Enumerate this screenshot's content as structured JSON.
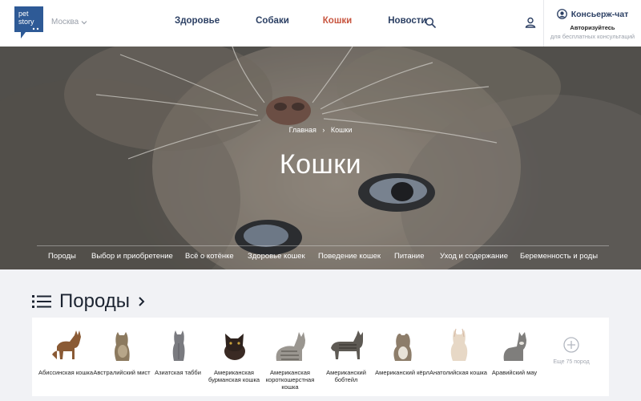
{
  "header": {
    "logo_line1": "pet",
    "logo_line2": "story",
    "city": "Москва",
    "nav": [
      {
        "label": "Здоровье",
        "active": false
      },
      {
        "label": "Собаки",
        "active": false
      },
      {
        "label": "Кошки",
        "active": true
      },
      {
        "label": "Новости",
        "active": false
      }
    ],
    "concierge": {
      "title": "Консьерж-чат",
      "subtitle": "Авторизуйтесь",
      "subtitle2": "для бесплатных консультаций"
    }
  },
  "hero": {
    "breadcrumb": {
      "home": "Главная",
      "current": "Кошки"
    },
    "title": "Кошки",
    "sub_nav": [
      "Породы",
      "Выбор и приобретение",
      "Всё о котёнке",
      "Здоровье кошек",
      "Поведение кошек",
      "Питание",
      "Уход и содержание",
      "Беременность и роды"
    ]
  },
  "breeds": {
    "title": "Породы",
    "items": [
      {
        "name": "Абиссинская кошка",
        "color": "#8a5a34"
      },
      {
        "name": "Австралийский мист",
        "color": "#8c7a5f"
      },
      {
        "name": "Азиатская табби",
        "color": "#7a7b80"
      },
      {
        "name": "Американская бурманская кошка",
        "color": "#3a2a24"
      },
      {
        "name": "Американская короткошерстная кошка",
        "color": "#9a9690"
      },
      {
        "name": "Американский бобтейл",
        "color": "#5e5a54"
      },
      {
        "name": "Американский кёрл",
        "color": "#8d7d6a"
      },
      {
        "name": "Анатолийская кошка",
        "color": "#e7d8c6"
      },
      {
        "name": "Аравийский мау",
        "color": "#7f7e7c"
      }
    ],
    "more_label": "Еще 75 пород"
  },
  "colors": {
    "nav_text": "#2b3f63",
    "nav_active": "#c8553f",
    "page_bg": "#f1f2f5"
  }
}
